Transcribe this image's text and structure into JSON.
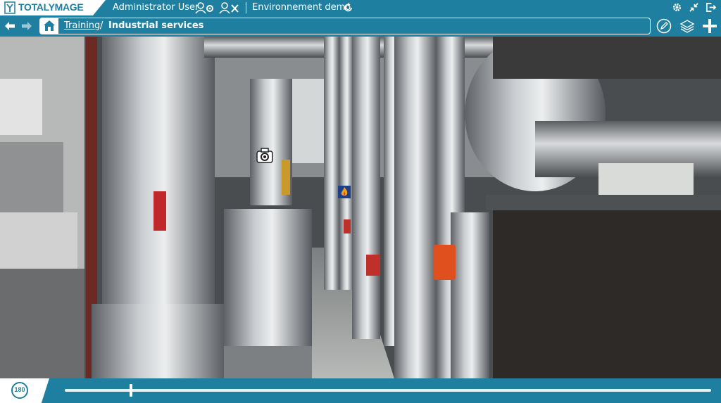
{
  "brand": {
    "logo_text": "TOTALYMAGE"
  },
  "topbar": {
    "user_label": "Administrator User",
    "environment_label": "Environnement demo"
  },
  "breadcrumb": {
    "link_label": "Training",
    "separator": "/",
    "current": "Industrial services"
  },
  "bottombar": {
    "view_mode_label": "180",
    "timeline_progress": 0.1
  },
  "colors": {
    "accent": "#1e7fa0",
    "panel": "#ffffff"
  },
  "icons": [
    "user-settings-icon",
    "user-logout-icon",
    "refresh-icon",
    "gear-icon",
    "collapse-icon",
    "exit-icon",
    "back-arrow-icon",
    "forward-arrow-icon",
    "home-icon",
    "edit-icon",
    "layers-icon",
    "plus-icon",
    "camera-hotspot-icon",
    "fire-hotspot-icon"
  ]
}
